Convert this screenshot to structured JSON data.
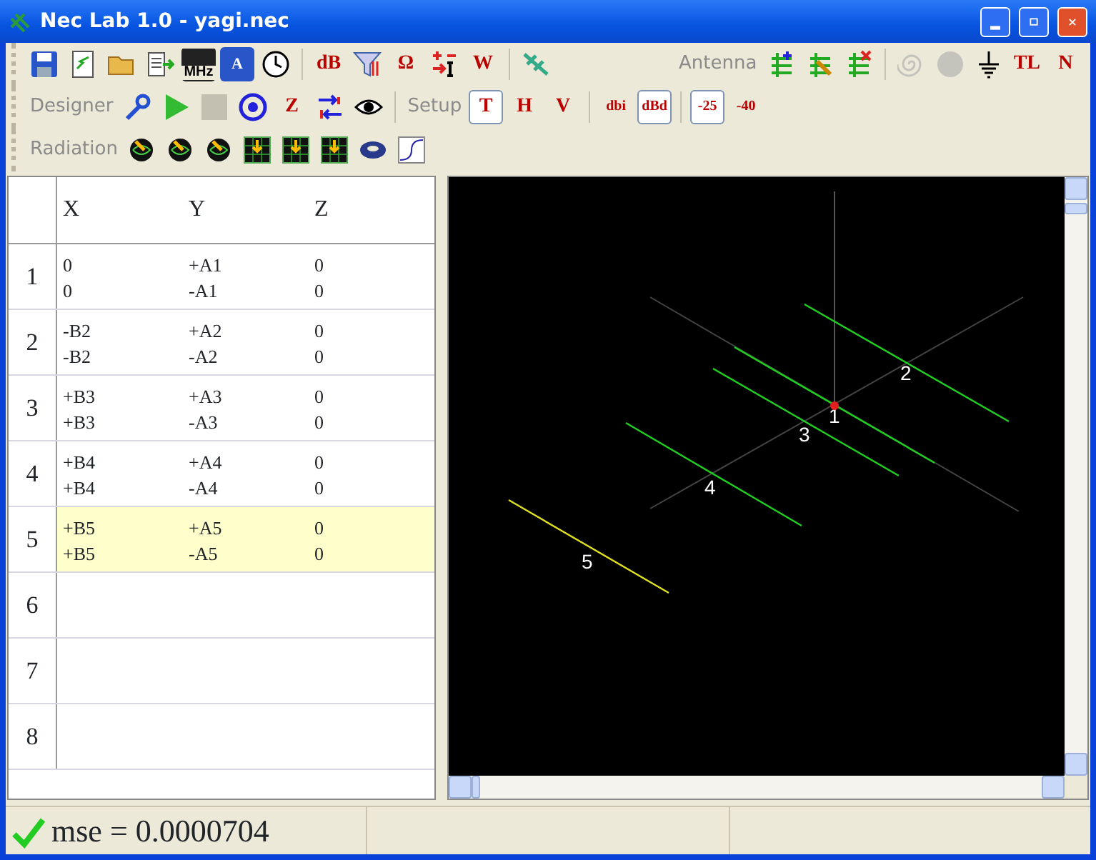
{
  "window": {
    "title": "Nec Lab 1.0 - yagi.nec"
  },
  "toolbars": [
    [
      {
        "kind": "floppy",
        "disabled": false,
        "pressed": false
      },
      {
        "kind": "document",
        "disabled": false,
        "pressed": false
      },
      {
        "kind": "folder",
        "disabled": false,
        "pressed": false
      },
      {
        "kind": "export",
        "disabled": false,
        "pressed": false
      },
      {
        "kind": "meter",
        "text": "MHz",
        "disabled": false,
        "pressed": false
      },
      {
        "kind": "floppytext",
        "text": "A",
        "disabled": false,
        "pressed": false
      },
      {
        "kind": "clock",
        "disabled": false,
        "pressed": false
      },
      {
        "kind": "separator"
      },
      {
        "kind": "letters",
        "text": "dB",
        "disabled": false,
        "pressed": false
      },
      {
        "kind": "filter",
        "disabled": false,
        "pressed": false
      },
      {
        "kind": "letters",
        "text": "Ω",
        "disabled": false,
        "pressed": false
      },
      {
        "kind": "current",
        "disabled": false,
        "pressed": false
      },
      {
        "kind": "letters",
        "text": "W",
        "disabled": false,
        "pressed": false
      },
      {
        "kind": "separator"
      },
      {
        "kind": "antenna",
        "disabled": false,
        "pressed": false
      },
      {
        "kind": "gap"
      },
      {
        "kind": "label",
        "text": "Antenna"
      },
      {
        "kind": "addelement",
        "disabled": false,
        "pressed": false
      },
      {
        "kind": "editelement",
        "disabled": false,
        "pressed": false
      },
      {
        "kind": "delelement",
        "disabled": false,
        "pressed": false
      },
      {
        "kind": "separator"
      },
      {
        "kind": "spiral",
        "disabled": true,
        "pressed": false
      },
      {
        "kind": "disk",
        "disabled": true,
        "pressed": false
      },
      {
        "kind": "ground",
        "disabled": false,
        "pressed": false
      },
      {
        "kind": "letters",
        "text": "TL",
        "disabled": false,
        "pressed": false
      },
      {
        "kind": "letters",
        "text": "N",
        "disabled": false,
        "pressed": false
      }
    ],
    [
      {
        "kind": "label",
        "text": "Designer"
      },
      {
        "kind": "wrench",
        "disabled": false,
        "pressed": false
      },
      {
        "kind": "play",
        "disabled": false,
        "pressed": false
      },
      {
        "kind": "stop",
        "disabled": true,
        "pressed": false
      },
      {
        "kind": "target",
        "disabled": false,
        "pressed": false
      },
      {
        "kind": "letters",
        "text": "Z",
        "disabled": false,
        "pressed": false
      },
      {
        "kind": "arrows",
        "disabled": false,
        "pressed": false
      },
      {
        "kind": "eye",
        "disabled": false,
        "pressed": false
      },
      {
        "kind": "separator"
      },
      {
        "kind": "label",
        "text": "Setup"
      },
      {
        "kind": "letters",
        "text": "T",
        "disabled": false,
        "pressed": true
      },
      {
        "kind": "letters",
        "text": "H",
        "disabled": false,
        "pressed": false
      },
      {
        "kind": "letters",
        "text": "V",
        "disabled": false,
        "pressed": false
      },
      {
        "kind": "separator"
      },
      {
        "kind": "letters",
        "text": "dbi",
        "disabled": false,
        "pressed": false
      },
      {
        "kind": "letters",
        "text": "dBd",
        "disabled": false,
        "pressed": true
      },
      {
        "kind": "separator"
      },
      {
        "kind": "letters",
        "text": "-25",
        "disabled": false,
        "pressed": true
      },
      {
        "kind": "letters",
        "text": "-40",
        "disabled": false,
        "pressed": false
      }
    ],
    [
      {
        "kind": "label",
        "text": "Radiation"
      },
      {
        "kind": "radiation",
        "disabled": false,
        "pressed": false
      },
      {
        "kind": "radiation",
        "disabled": false,
        "pressed": false
      },
      {
        "kind": "radiation",
        "disabled": false,
        "pressed": false
      },
      {
        "kind": "plot",
        "disabled": false,
        "pressed": false
      },
      {
        "kind": "plot",
        "disabled": false,
        "pressed": false
      },
      {
        "kind": "plot",
        "disabled": false,
        "pressed": false
      },
      {
        "kind": "torus",
        "disabled": false,
        "pressed": false
      },
      {
        "kind": "curve",
        "disabled": false,
        "pressed": false
      }
    ]
  ],
  "table": {
    "columns": [
      "X",
      "Y",
      "Z"
    ],
    "rows": [
      {
        "header": "1",
        "selected": false,
        "cells": [
          [
            "0",
            "0"
          ],
          [
            "+A1",
            "-A1"
          ],
          [
            "0",
            "0"
          ]
        ]
      },
      {
        "header": "2",
        "selected": false,
        "cells": [
          [
            "-B2",
            "-B2"
          ],
          [
            "+A2",
            "-A2"
          ],
          [
            "0",
            "0"
          ]
        ]
      },
      {
        "header": "3",
        "selected": false,
        "cells": [
          [
            "+B3",
            "+B3"
          ],
          [
            "+A3",
            "-A3"
          ],
          [
            "0",
            "0"
          ]
        ]
      },
      {
        "header": "4",
        "selected": false,
        "cells": [
          [
            "+B4",
            "+B4"
          ],
          [
            "+A4",
            "-A4"
          ],
          [
            "0",
            "0"
          ]
        ]
      },
      {
        "header": "5",
        "selected": true,
        "cells": [
          [
            "+B5",
            "+B5"
          ],
          [
            "+A5",
            "-A5"
          ],
          [
            "0",
            "0"
          ]
        ]
      },
      {
        "header": "6",
        "selected": false,
        "cells": [
          [],
          [],
          []
        ]
      },
      {
        "header": "7",
        "selected": false,
        "cells": [
          [],
          [],
          []
        ]
      },
      {
        "header": "8",
        "selected": false,
        "cells": [
          [],
          [],
          []
        ]
      }
    ]
  },
  "view": {
    "elements": [
      {
        "label": "1",
        "selected": false,
        "feed": true
      },
      {
        "label": "2",
        "selected": false,
        "feed": false
      },
      {
        "label": "3",
        "selected": false,
        "feed": false
      },
      {
        "label": "4",
        "selected": false,
        "feed": false
      },
      {
        "label": "5",
        "selected": true,
        "feed": false
      }
    ]
  },
  "status_bar": {
    "ok": true,
    "text": "mse = 0.0000704"
  }
}
